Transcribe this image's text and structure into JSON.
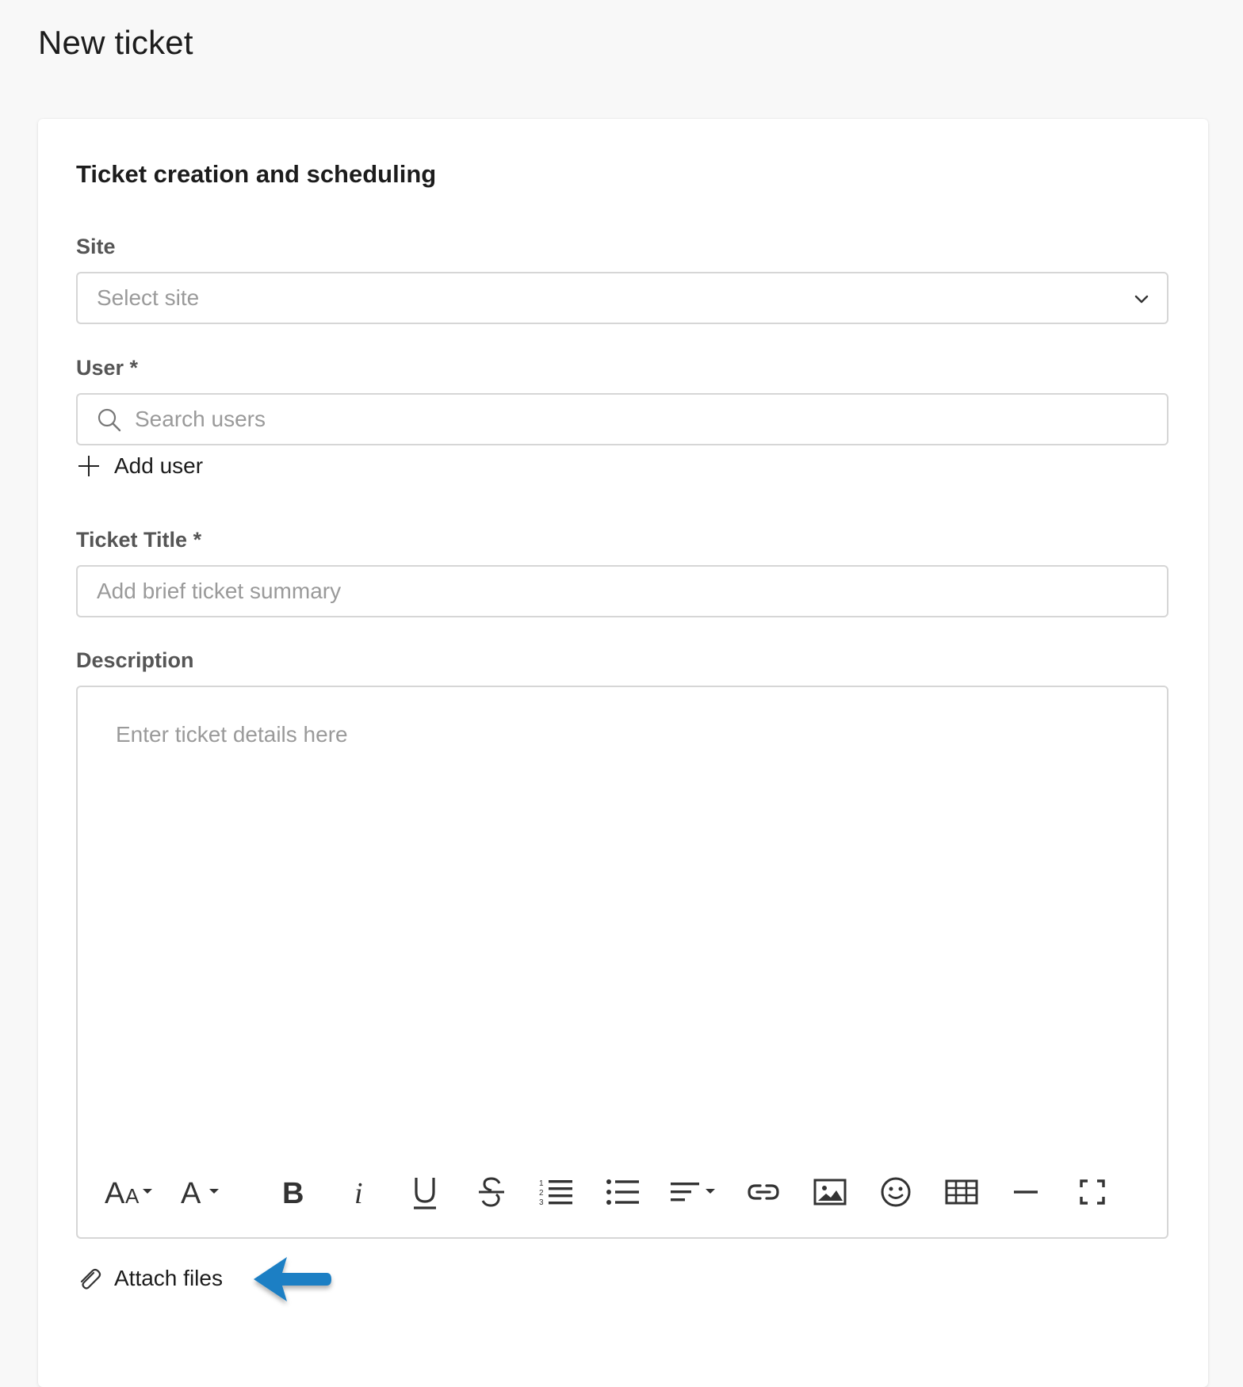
{
  "page": {
    "title": "New ticket"
  },
  "form": {
    "section_title": "Ticket creation and scheduling",
    "site": {
      "label": "Site",
      "placeholder": "Select site"
    },
    "user": {
      "label": "User *",
      "placeholder": "Search users",
      "add_label": "Add user"
    },
    "ticket_title": {
      "label": "Ticket Title *",
      "placeholder": "Add brief ticket summary"
    },
    "description": {
      "label": "Description",
      "placeholder": "Enter ticket details here",
      "toolbar": [
        {
          "name": "font-size-icon",
          "label": "AA"
        },
        {
          "name": "font-color-icon",
          "label": "A"
        },
        {
          "name": "bold-icon",
          "label": "B"
        },
        {
          "name": "italic-icon",
          "label": "i"
        },
        {
          "name": "underline-icon",
          "label": "U"
        },
        {
          "name": "strikethrough-icon",
          "label": "S"
        },
        {
          "name": "ordered-list-icon",
          "label": ""
        },
        {
          "name": "unordered-list-icon",
          "label": ""
        },
        {
          "name": "align-icon",
          "label": ""
        },
        {
          "name": "link-icon",
          "label": ""
        },
        {
          "name": "image-icon",
          "label": ""
        },
        {
          "name": "emoji-icon",
          "label": ""
        },
        {
          "name": "table-icon",
          "label": ""
        },
        {
          "name": "horizontal-rule-icon",
          "label": ""
        },
        {
          "name": "fullscreen-icon",
          "label": ""
        }
      ]
    },
    "attach": {
      "label": "Attach files"
    }
  },
  "colors": {
    "background": "#f8f8f8",
    "card": "#ffffff",
    "border": "#d6d6d6",
    "placeholder": "#9a9a9a",
    "label": "#555555",
    "callout_arrow": "#1a7fc4"
  }
}
